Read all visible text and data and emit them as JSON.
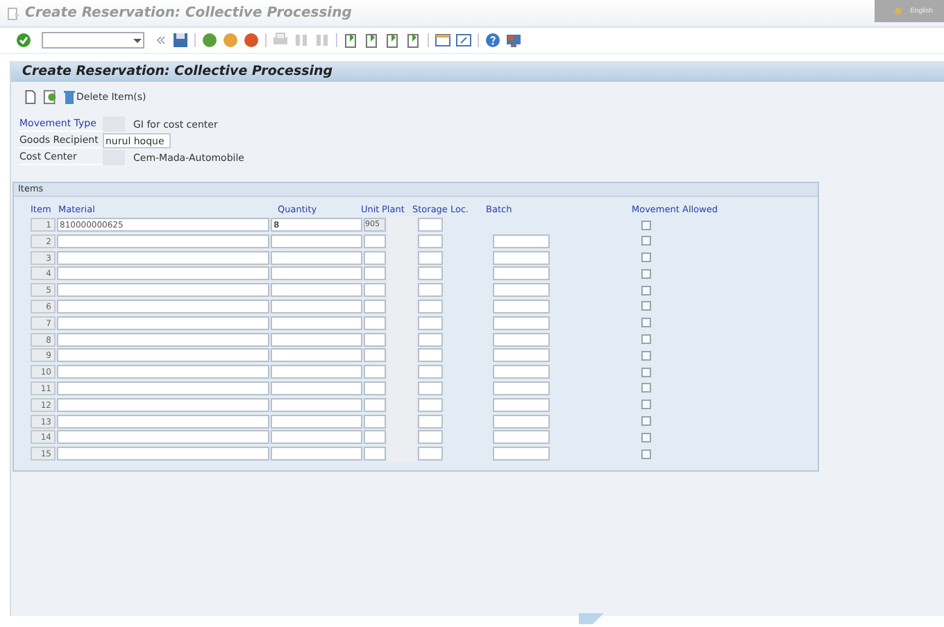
{
  "window": {
    "title": "Create Reservation: Collective Processing",
    "language_button": "English"
  },
  "header": {
    "title": "Create Reservation: Collective Processing"
  },
  "app_toolbar": {
    "delete_button": "Delete Item(s)"
  },
  "fields": [
    {
      "label": "Movement Type",
      "link": true,
      "description": "GI for cost center",
      "editable": false
    },
    {
      "label": "Goods Recipient",
      "link": false,
      "value": "nurul hoque",
      "editable": true
    },
    {
      "label": "Cost Center",
      "link": false,
      "description": "Cem-Mada-Automobile",
      "editable": false
    }
  ],
  "items": {
    "title": "Items",
    "columns": [
      "Item",
      "Material",
      "Quantity",
      "Unit",
      "Plant",
      "Storage Loc.",
      "Batch",
      "Movement Allowed"
    ],
    "rows": [
      {
        "item": "1",
        "material": "810000000625",
        "quantity": "8",
        "unit": "905",
        "batch_field": false,
        "checked": false
      },
      {
        "item": "2",
        "material": "",
        "quantity": "",
        "unit": "",
        "batch_field": true,
        "checked": false
      },
      {
        "item": "3",
        "material": "",
        "quantity": "",
        "unit": "",
        "batch_field": true,
        "checked": false
      },
      {
        "item": "4",
        "material": "",
        "quantity": "",
        "unit": "",
        "batch_field": true,
        "checked": false
      },
      {
        "item": "5",
        "material": "",
        "quantity": "",
        "unit": "",
        "batch_field": true,
        "checked": false
      },
      {
        "item": "6",
        "material": "",
        "quantity": "",
        "unit": "",
        "batch_field": true,
        "checked": false
      },
      {
        "item": "7",
        "material": "",
        "quantity": "",
        "unit": "",
        "batch_field": true,
        "checked": false
      },
      {
        "item": "8",
        "material": "",
        "quantity": "",
        "unit": "",
        "batch_field": true,
        "checked": false
      },
      {
        "item": "9",
        "material": "",
        "quantity": "",
        "unit": "",
        "batch_field": true,
        "checked": false
      },
      {
        "item": "10",
        "material": "",
        "quantity": "",
        "unit": "",
        "batch_field": true,
        "checked": false
      },
      {
        "item": "11",
        "material": "",
        "quantity": "",
        "unit": "",
        "batch_field": true,
        "checked": false
      },
      {
        "item": "12",
        "material": "",
        "quantity": "",
        "unit": "",
        "batch_field": true,
        "checked": false
      },
      {
        "item": "13",
        "material": "",
        "quantity": "",
        "unit": "",
        "batch_field": true,
        "checked": false
      },
      {
        "item": "14",
        "material": "",
        "quantity": "",
        "unit": "",
        "batch_field": true,
        "checked": false
      },
      {
        "item": "15",
        "material": "",
        "quantity": "",
        "unit": "",
        "batch_field": true,
        "checked": false
      }
    ]
  }
}
